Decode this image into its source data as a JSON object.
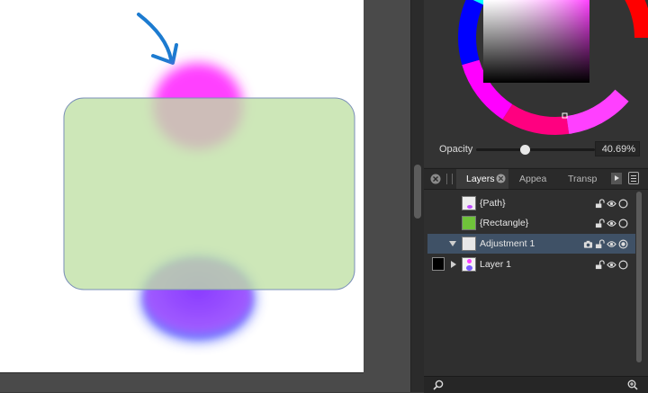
{
  "canvas": {
    "colors": {
      "rectangle_fill": "#cbe7b6",
      "rectangle_stroke": "#7a8fb8",
      "top_blob": "#ff40ff",
      "bottom_blob": "#8855ff",
      "arrow": "#1c7bd0"
    }
  },
  "color_panel": {
    "opacity_label": "Opacity",
    "opacity_value": "40.69%",
    "opacity_fraction": 0.4069
  },
  "tabs": [
    {
      "label": "Layers"
    },
    {
      "label": "Appea"
    },
    {
      "label": "Transp"
    }
  ],
  "layers": [
    {
      "name": "{Path}"
    },
    {
      "name": "{Rectangle}"
    },
    {
      "name": "Adjustment 1"
    },
    {
      "name": "Layer 1"
    }
  ],
  "icons": {
    "close": "close-icon",
    "lock": "lock-open-icon",
    "eye": "eye-icon",
    "circle": "circle-icon",
    "camera": "camera-icon",
    "search": "search-icon",
    "zoom": "zoom-in-icon",
    "menu": "panel-menu-icon",
    "more": "play-icon"
  }
}
